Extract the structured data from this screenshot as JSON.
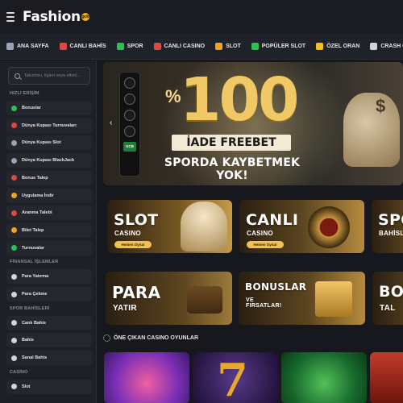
{
  "brand": {
    "logo_text": "Fashion",
    "logo_badge": "gcb"
  },
  "nav": [
    {
      "label": "ANA SAYFA",
      "icon": "home-icon",
      "color": "#9aa3b3"
    },
    {
      "label": "CANLI BAHİS",
      "icon": "live-bet-icon",
      "color": "#e0473f"
    },
    {
      "label": "SPOR",
      "icon": "sport-icon",
      "color": "#2fbf55"
    },
    {
      "label": "CANLI CASINO",
      "icon": "live-casino-icon",
      "color": "#e0473f"
    },
    {
      "label": "SLOT",
      "icon": "slot-icon",
      "color": "#f2a31b"
    },
    {
      "label": "POPÜLER SLOT",
      "icon": "star-icon",
      "color": "#2fbf55"
    },
    {
      "label": "ÖZEL ORAN",
      "icon": "special-odds-icon",
      "color": "#f2c21b"
    },
    {
      "label": "CRASH GAMES",
      "icon": "rocket-icon",
      "color": "#cfd3da"
    }
  ],
  "sidebar": {
    "search_placeholder": "Takımları, ligleri veya etkinl...",
    "section_quick": "HIZLI ERİŞİM",
    "quick_items": [
      {
        "label": "Bonuslar",
        "icon": "gift-icon",
        "color": "#2fbf55"
      },
      {
        "label": "Dünya Kupası Turnuvaları",
        "icon": "trophy-icon",
        "color": "#e0473f"
      },
      {
        "label": "Dünya Kupası Slot",
        "icon": "globe-icon",
        "color": "#9aa3b3"
      },
      {
        "label": "Dünya Kupası BlackJack",
        "icon": "globe-icon",
        "color": "#9aa3b3"
      },
      {
        "label": "Bonus Talep",
        "icon": "ticket-icon",
        "color": "#e0473f"
      },
      {
        "label": "Uygulama İndir",
        "icon": "download-icon",
        "color": "#f2a31b"
      },
      {
        "label": "Aranma Talebi",
        "icon": "phone-icon",
        "color": "#e0473f"
      },
      {
        "label": "Bilet Talep",
        "icon": "ticket-icon",
        "color": "#f2a31b"
      },
      {
        "label": "Turnuvalar",
        "icon": "trophy-icon",
        "color": "#2fbf55"
      }
    ],
    "section_finance": "FİNANSAL İŞLEMLER",
    "finance_items": [
      {
        "label": "Para Yatırma",
        "icon": "deposit-icon",
        "color": "#cfd3da"
      },
      {
        "label": "Para Çekme",
        "icon": "withdraw-icon",
        "color": "#cfd3da"
      }
    ],
    "section_sports": "SPOR BAHİSLERİ",
    "sports_items": [
      {
        "label": "Canlı Bahis",
        "icon": "live-icon",
        "color": "#cfd3da"
      },
      {
        "label": "Bahis",
        "icon": "ball-icon",
        "color": "#cfd3da"
      },
      {
        "label": "Sanal Bahis",
        "icon": "virtual-icon",
        "color": "#cfd3da"
      }
    ],
    "section_casino": "CASİNO",
    "casino_items": [
      {
        "label": "Slot",
        "icon": "slot-icon",
        "color": "#cfd3da"
      }
    ]
  },
  "hero": {
    "percent": "%",
    "number": "100",
    "band": "İADE FREEBET",
    "subtitle": "SPORDA KAYBETMEK YOK!",
    "badge": "GCB"
  },
  "cards_row1": [
    {
      "title": "SLOT",
      "sub": "CASINO",
      "pill": "Hemen Oyna!"
    },
    {
      "title": "CANLI",
      "sub": "CASINO",
      "pill": "Hemen Oyna!"
    },
    {
      "title": "SPO",
      "sub": "BAHİSL"
    }
  ],
  "cards_row2": [
    {
      "title": "PARA",
      "sub": "YATIR"
    },
    {
      "title": "BONUSLAR",
      "sub": "VE FIRSATLAR!"
    },
    {
      "title": "BON",
      "sub": "TAL"
    }
  ],
  "featured": {
    "title": "ÖNE ÇIKAN CASINO OYUNLAR"
  }
}
